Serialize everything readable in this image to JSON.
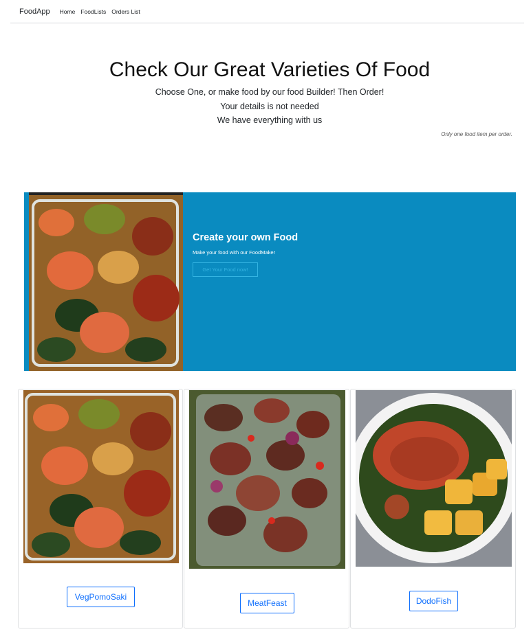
{
  "navbar": {
    "brand": "FoodApp",
    "links": [
      "Home",
      "FoodLists",
      "Orders List"
    ]
  },
  "hero": {
    "title": "Check Our Great Varieties Of Food",
    "line1": "Choose One, or make food by our food Builder! Then Order!",
    "line2": "Your details is not needed",
    "line3": "We have everything with us",
    "note": "Only one food item per order."
  },
  "banner": {
    "title": "Create your own Food",
    "text": "Make your food with our FoodMaker",
    "button": "Get Your Food now!",
    "bg_color": "#0a8bc0"
  },
  "foods": [
    {
      "name": "VegPomoSaki"
    },
    {
      "name": "MeatFeast"
    },
    {
      "name": "DodoFish"
    }
  ],
  "colors": {
    "primary": "#0d6efd",
    "banner": "#0a8bc0"
  }
}
